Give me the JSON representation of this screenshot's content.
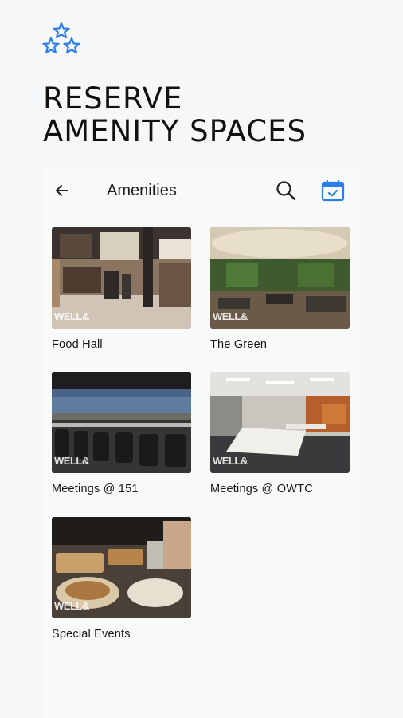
{
  "promo": {
    "logo_icon": "three-stars-icon",
    "headline_line1": "RESERVE",
    "headline_line2": "AMENITY SPACES"
  },
  "appbar": {
    "back_icon": "arrow-left-icon",
    "title": "Amenities",
    "search_icon": "search-icon",
    "calendar_icon": "calendar-check-icon",
    "accent_color": "#2b7de9"
  },
  "amenities": [
    {
      "label": "Food Hall",
      "watermark": "WELL&"
    },
    {
      "label": "The Green",
      "watermark": "WELL&"
    },
    {
      "label": "Meetings @ 151",
      "watermark": "WELL&"
    },
    {
      "label": "Meetings @ OWTC",
      "watermark": "WELL&"
    },
    {
      "label": "Special Events",
      "watermark": "WELL&"
    }
  ]
}
